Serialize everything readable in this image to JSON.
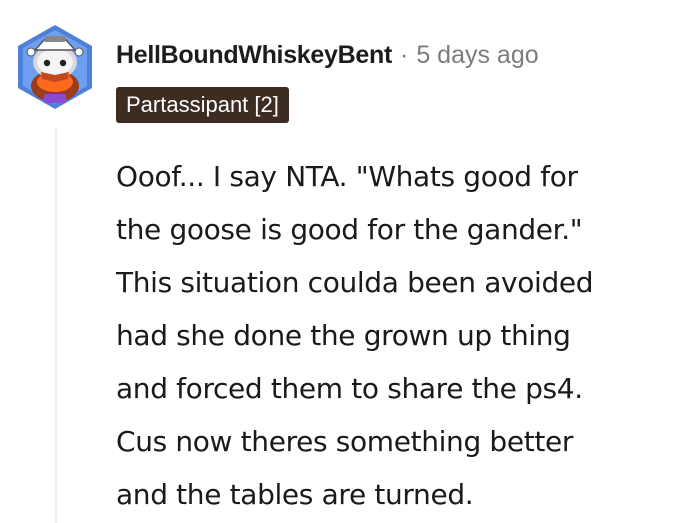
{
  "comment": {
    "username": "HellBoundWhiskeyBent",
    "separator": "·",
    "timestamp": "5 days ago",
    "flair": "Partassipant [2]",
    "body_lines": [
      "Ooof... I say NTA. \"Whats good for",
      "the goose is good for the gander.\"",
      "This situation coulda been avoided",
      "had she done the grown up thing",
      "and forced them to share the ps4.",
      "Cus now theres something better",
      "and the tables are turned."
    ]
  },
  "avatar": {
    "icon": "snoo-avatar-icon"
  },
  "colors": {
    "flair_background": "#3d2c22",
    "flair_text": "#ffffff",
    "meta_gray": "#7c7c7c",
    "text": "#1a1a1b",
    "thread_line": "#edeff1"
  }
}
